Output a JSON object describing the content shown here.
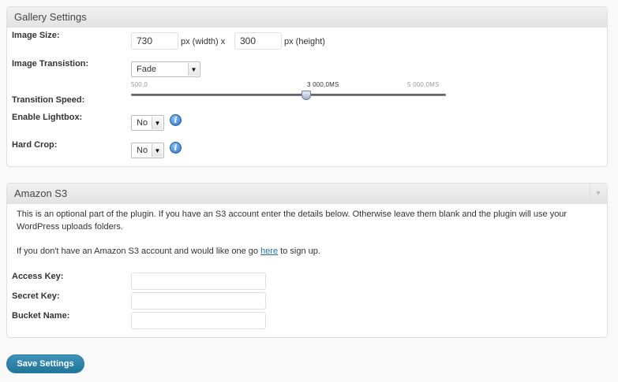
{
  "gallery": {
    "title": "Gallery Settings",
    "image_size": {
      "label": "Image Size:",
      "width": "730",
      "width_unit": "px (width) x",
      "height": "300",
      "height_unit": "px (height)"
    },
    "transition": {
      "label": "Image Transistion:",
      "value": "Fade"
    },
    "speed": {
      "label": "Transition Speed:",
      "min": "500,0",
      "current": "3 000,0MS",
      "max": "5 000,0MS",
      "value_fraction": 0.5
    },
    "lightbox": {
      "label": "Enable Lightbox:",
      "value": "No"
    },
    "hard_crop": {
      "label": "Hard Crop:",
      "value": "No"
    }
  },
  "amazon": {
    "title": "Amazon S3",
    "intro": "This is an optional part of the plugin. If you have an S3 account enter the details below. Otherwise leave them blank and the plugin will use your WordPress uploads folders.",
    "signup_prefix": "If you don't have an Amazon S3 account and would like one go ",
    "signup_link": "here",
    "signup_suffix": " to sign up.",
    "access_key": {
      "label": "Access Key:",
      "value": ""
    },
    "secret_key": {
      "label": "Secret Key:",
      "value": ""
    },
    "bucket_name": {
      "label": "Bucket Name:",
      "value": ""
    }
  },
  "save_label": "Save Settings",
  "colors": {
    "accent": "#21759b",
    "info": "#2a6fbf"
  },
  "icons": {
    "info": "info-icon",
    "collapse": "triangle-down-icon",
    "dropdown": "chevron-down-icon"
  }
}
